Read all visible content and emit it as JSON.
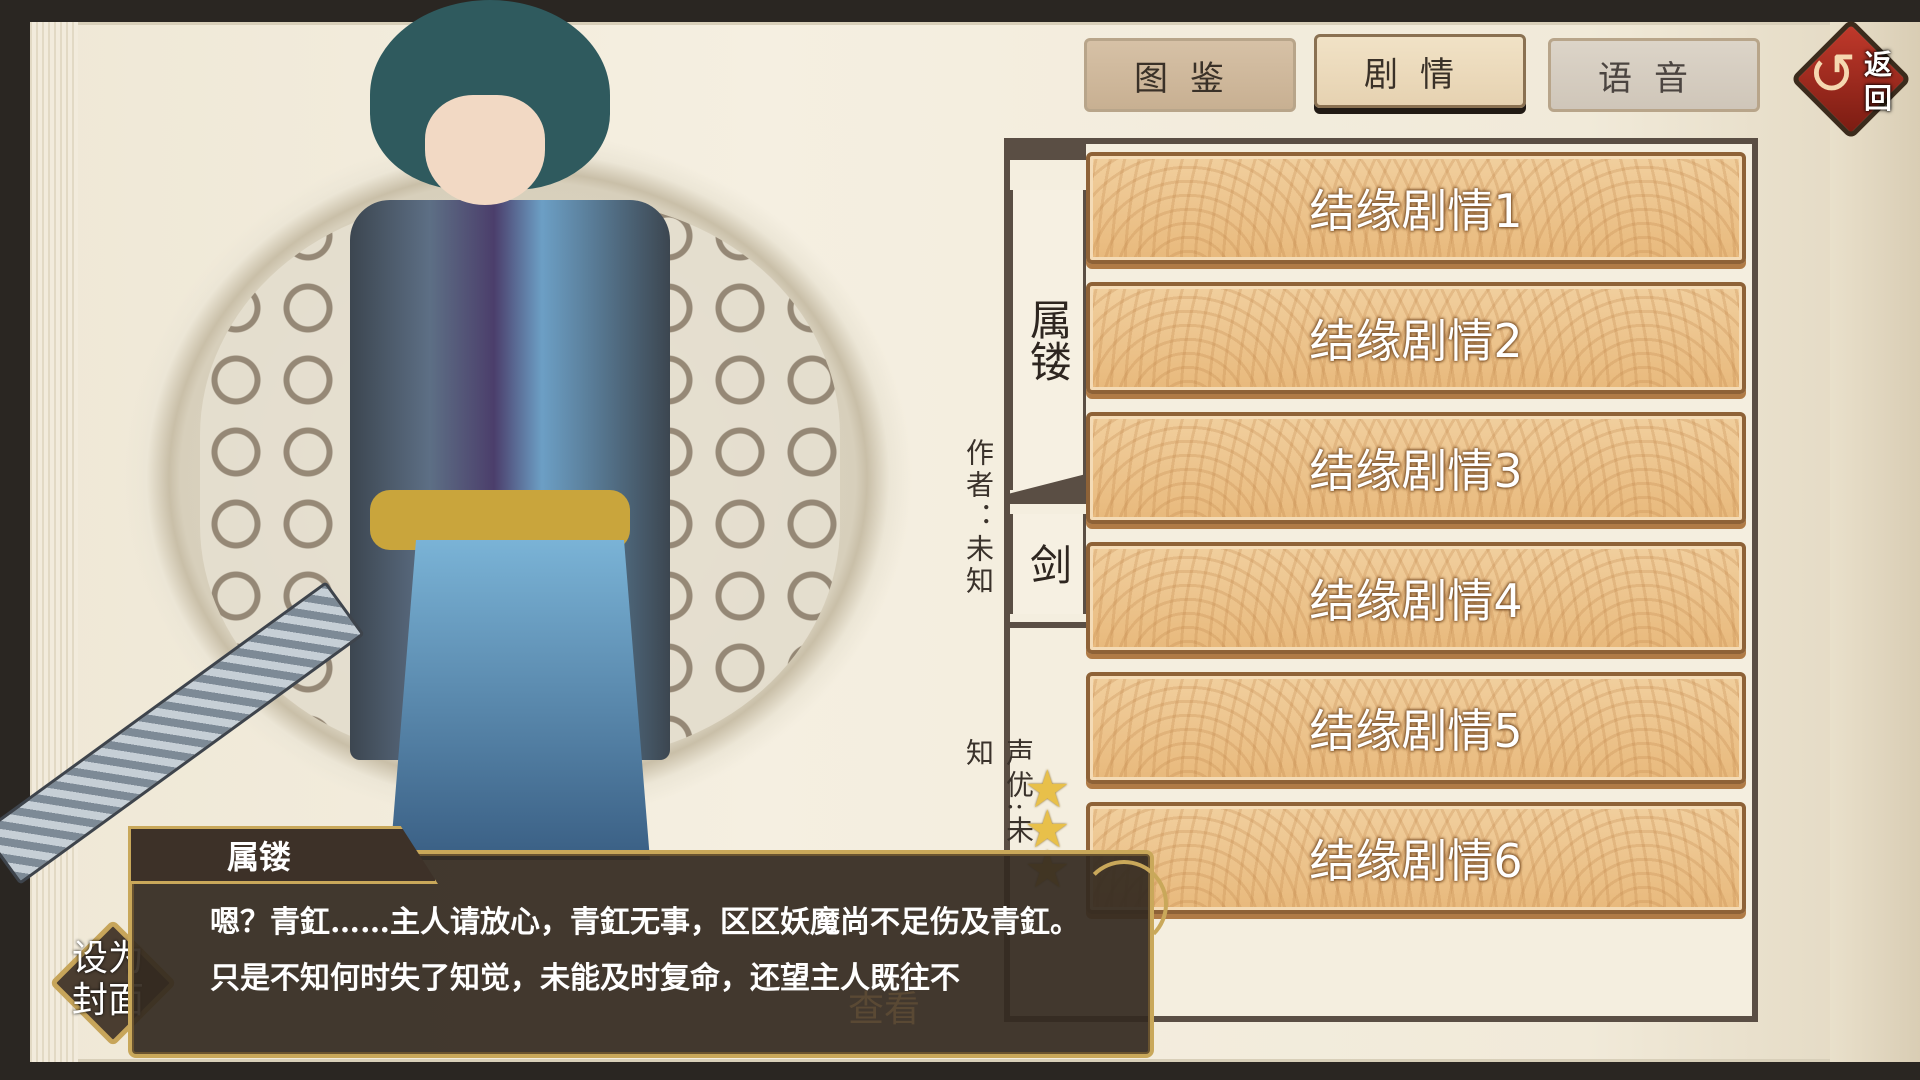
{
  "tabs": [
    {
      "label": "图鉴",
      "state": "inactive"
    },
    {
      "label": "剧情",
      "state": "active"
    },
    {
      "label": "语音",
      "state": "disabled"
    }
  ],
  "back_button": {
    "label": "返回"
  },
  "character": {
    "name": "属镂",
    "type": "剑",
    "author": "作者：未知",
    "voice_actor": "声优:未知",
    "stars": 3
  },
  "stories": [
    "结缘剧情1",
    "结缘剧情2",
    "结缘剧情3",
    "结缘剧情4",
    "结缘剧情5",
    "结缘剧情6"
  ],
  "set_cover_button": {
    "label": "设为封面"
  },
  "view_button": {
    "label": "查看"
  },
  "dialog": {
    "speaker": "属镂",
    "text": "嗯？青釭……主人请放心，青釭无事，区区妖魔尚不足伤及青釭。只是不知何时失了知觉，未能及时复命，还望主人既往不"
  },
  "colors": {
    "accent_gold": "#c9a85a",
    "panel_border": "#5a4e44",
    "story_button": "#e8b97c",
    "back_button": "#c0392b"
  }
}
